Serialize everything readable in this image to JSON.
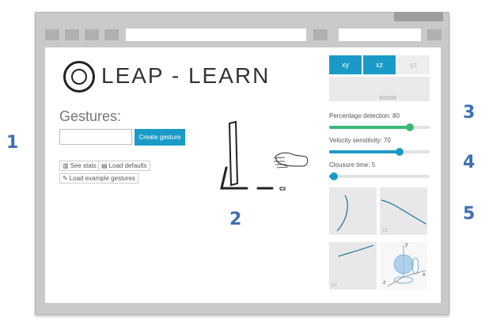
{
  "brand": {
    "title": "LEAP - LEARN"
  },
  "gestures": {
    "title": "Gestures:",
    "input_value": "",
    "create_button": "Create gesture",
    "see_stats": "See stats",
    "load_defaults": "Load defaults",
    "load_examples": "Load example gestures"
  },
  "callouts": {
    "one": "1",
    "two": "2",
    "three": "3",
    "four": "4",
    "five": "5"
  },
  "tabs": [
    {
      "label": "xy",
      "active": true
    },
    {
      "label": "xz",
      "active": true
    },
    {
      "label": "yz",
      "active": false
    }
  ],
  "sliders": {
    "percentage": {
      "label": "Percentage detection: 80",
      "value": 80,
      "max": 100,
      "color": "#3cb878"
    },
    "velocity": {
      "label": "Velocity sensitivity: 70",
      "value": 70,
      "color": "#1a9bc7"
    },
    "closure": {
      "label": "Clousure time: 5",
      "value": 5,
      "color": "#1a9bc7"
    }
  },
  "projections": {
    "xz_label": "xz",
    "yz_label": "yz",
    "axis_y": "y",
    "axis_x": "x",
    "axis_z": "z"
  },
  "colors": {
    "accent": "#1a9bc7",
    "green": "#3cb878",
    "callout": "#3f6fb5"
  }
}
